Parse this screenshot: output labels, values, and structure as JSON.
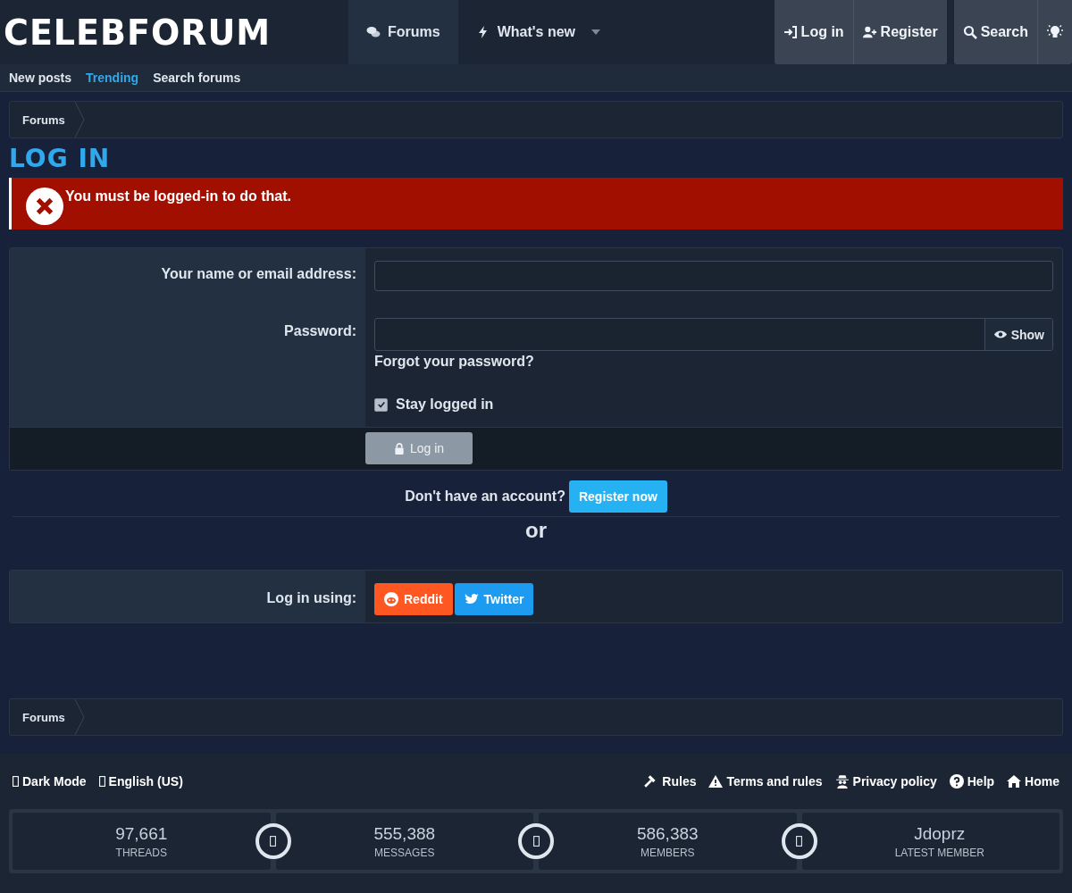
{
  "header": {
    "logo": "CELEBFORUM",
    "nav_tabs": [
      {
        "label": "Forums",
        "kind": "forums",
        "selected": true
      },
      {
        "label": "What's new",
        "kind": "new",
        "selected": false
      }
    ],
    "user_buttons": [
      {
        "label": "Log in",
        "kind": "login"
      },
      {
        "label": "Register",
        "kind": "register"
      }
    ],
    "search_button": {
      "label": "Search"
    }
  },
  "sub_nav": [
    {
      "label": "New posts",
      "selected": false
    },
    {
      "label": "Trending",
      "selected": true
    },
    {
      "label": "Search forums",
      "selected": false
    }
  ],
  "breadcrumb_top": [
    "Forums"
  ],
  "page_title": "LOG IN",
  "error_message": "You must be logged-in to do that.",
  "form": {
    "name_label": "Your name or email address:",
    "password_label": "Password:",
    "show_toggle": "Show",
    "forgot_link": "Forgot your password?",
    "stay_logged_in": {
      "label": "Stay logged in",
      "checked": true
    },
    "submit": {
      "label": "Log in",
      "disabled": true
    }
  },
  "register_prompt": {
    "text": "Don't have an account?",
    "button": "Register now"
  },
  "divider_text": "or",
  "login_using": {
    "label": "Log in using:",
    "providers": [
      {
        "label": "Reddit",
        "kind": "reddit"
      },
      {
        "label": "Twitter",
        "kind": "twitter"
      }
    ]
  },
  "breadcrumb_bottom": [
    "Forums"
  ],
  "footer": {
    "left_links": [
      {
        "label": "Dark Mode"
      },
      {
        "label": "English (US)"
      }
    ],
    "right_links": [
      {
        "label": "Rules",
        "kind": "rules"
      },
      {
        "label": "Terms and rules",
        "kind": "terms"
      },
      {
        "label": "Privacy policy",
        "kind": "privacy"
      },
      {
        "label": "Help",
        "kind": "help"
      },
      {
        "label": "Home",
        "kind": "home"
      }
    ]
  },
  "stats": [
    {
      "value": "97,661",
      "label": "THREADS"
    },
    {
      "value": "555,388",
      "label": "MESSAGES"
    },
    {
      "value": "586,383",
      "label": "MEMBERS"
    },
    {
      "value": "Jdoprz",
      "label": "LATEST MEMBER"
    }
  ]
}
